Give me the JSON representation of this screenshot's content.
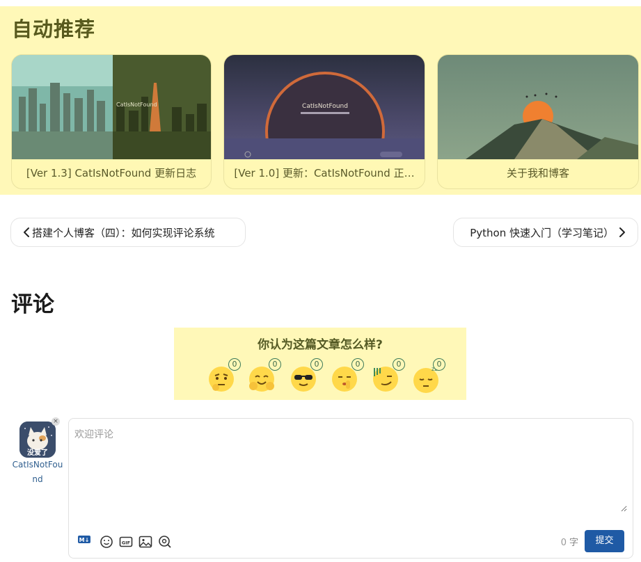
{
  "recommend": {
    "title": "自动推荐",
    "cards": [
      {
        "caption": "[Ver 1.3] CatIsNotFound 更新日志"
      },
      {
        "caption": "[Ver 1.0] 更新：CatIsNotFound 正…",
        "thumb_title": "CatIsNotFound"
      },
      {
        "caption": "关于我和博客"
      }
    ]
  },
  "nav": {
    "prev_label": "搭建个人博客（四）：如何实现评论系统",
    "next_label": "Python 快速入门（学习笔记）"
  },
  "comments": {
    "title": "评论",
    "reaction_question": "你认为这篇文章怎么样?",
    "reactions": [
      {
        "icon": "thinking-face-icon",
        "count": "0"
      },
      {
        "icon": "hugging-face-icon",
        "count": "0"
      },
      {
        "icon": "sunglasses-face-icon",
        "count": "0"
      },
      {
        "icon": "shushing-face-icon",
        "count": "0"
      },
      {
        "icon": "smirk-face-icon",
        "count": "0"
      },
      {
        "icon": "sleepy-face-icon",
        "count": "0"
      }
    ],
    "user": {
      "name": "CatIsNotFound",
      "avatar_text": "没爱了"
    },
    "editor": {
      "placeholder": "欢迎评论",
      "word_count": "0",
      "word_unit": "字",
      "submit_label": "提交",
      "markdown_badge": "M↓"
    }
  },
  "colors": {
    "accent": "#1f5aa5",
    "highlight": "#fff8b8"
  }
}
